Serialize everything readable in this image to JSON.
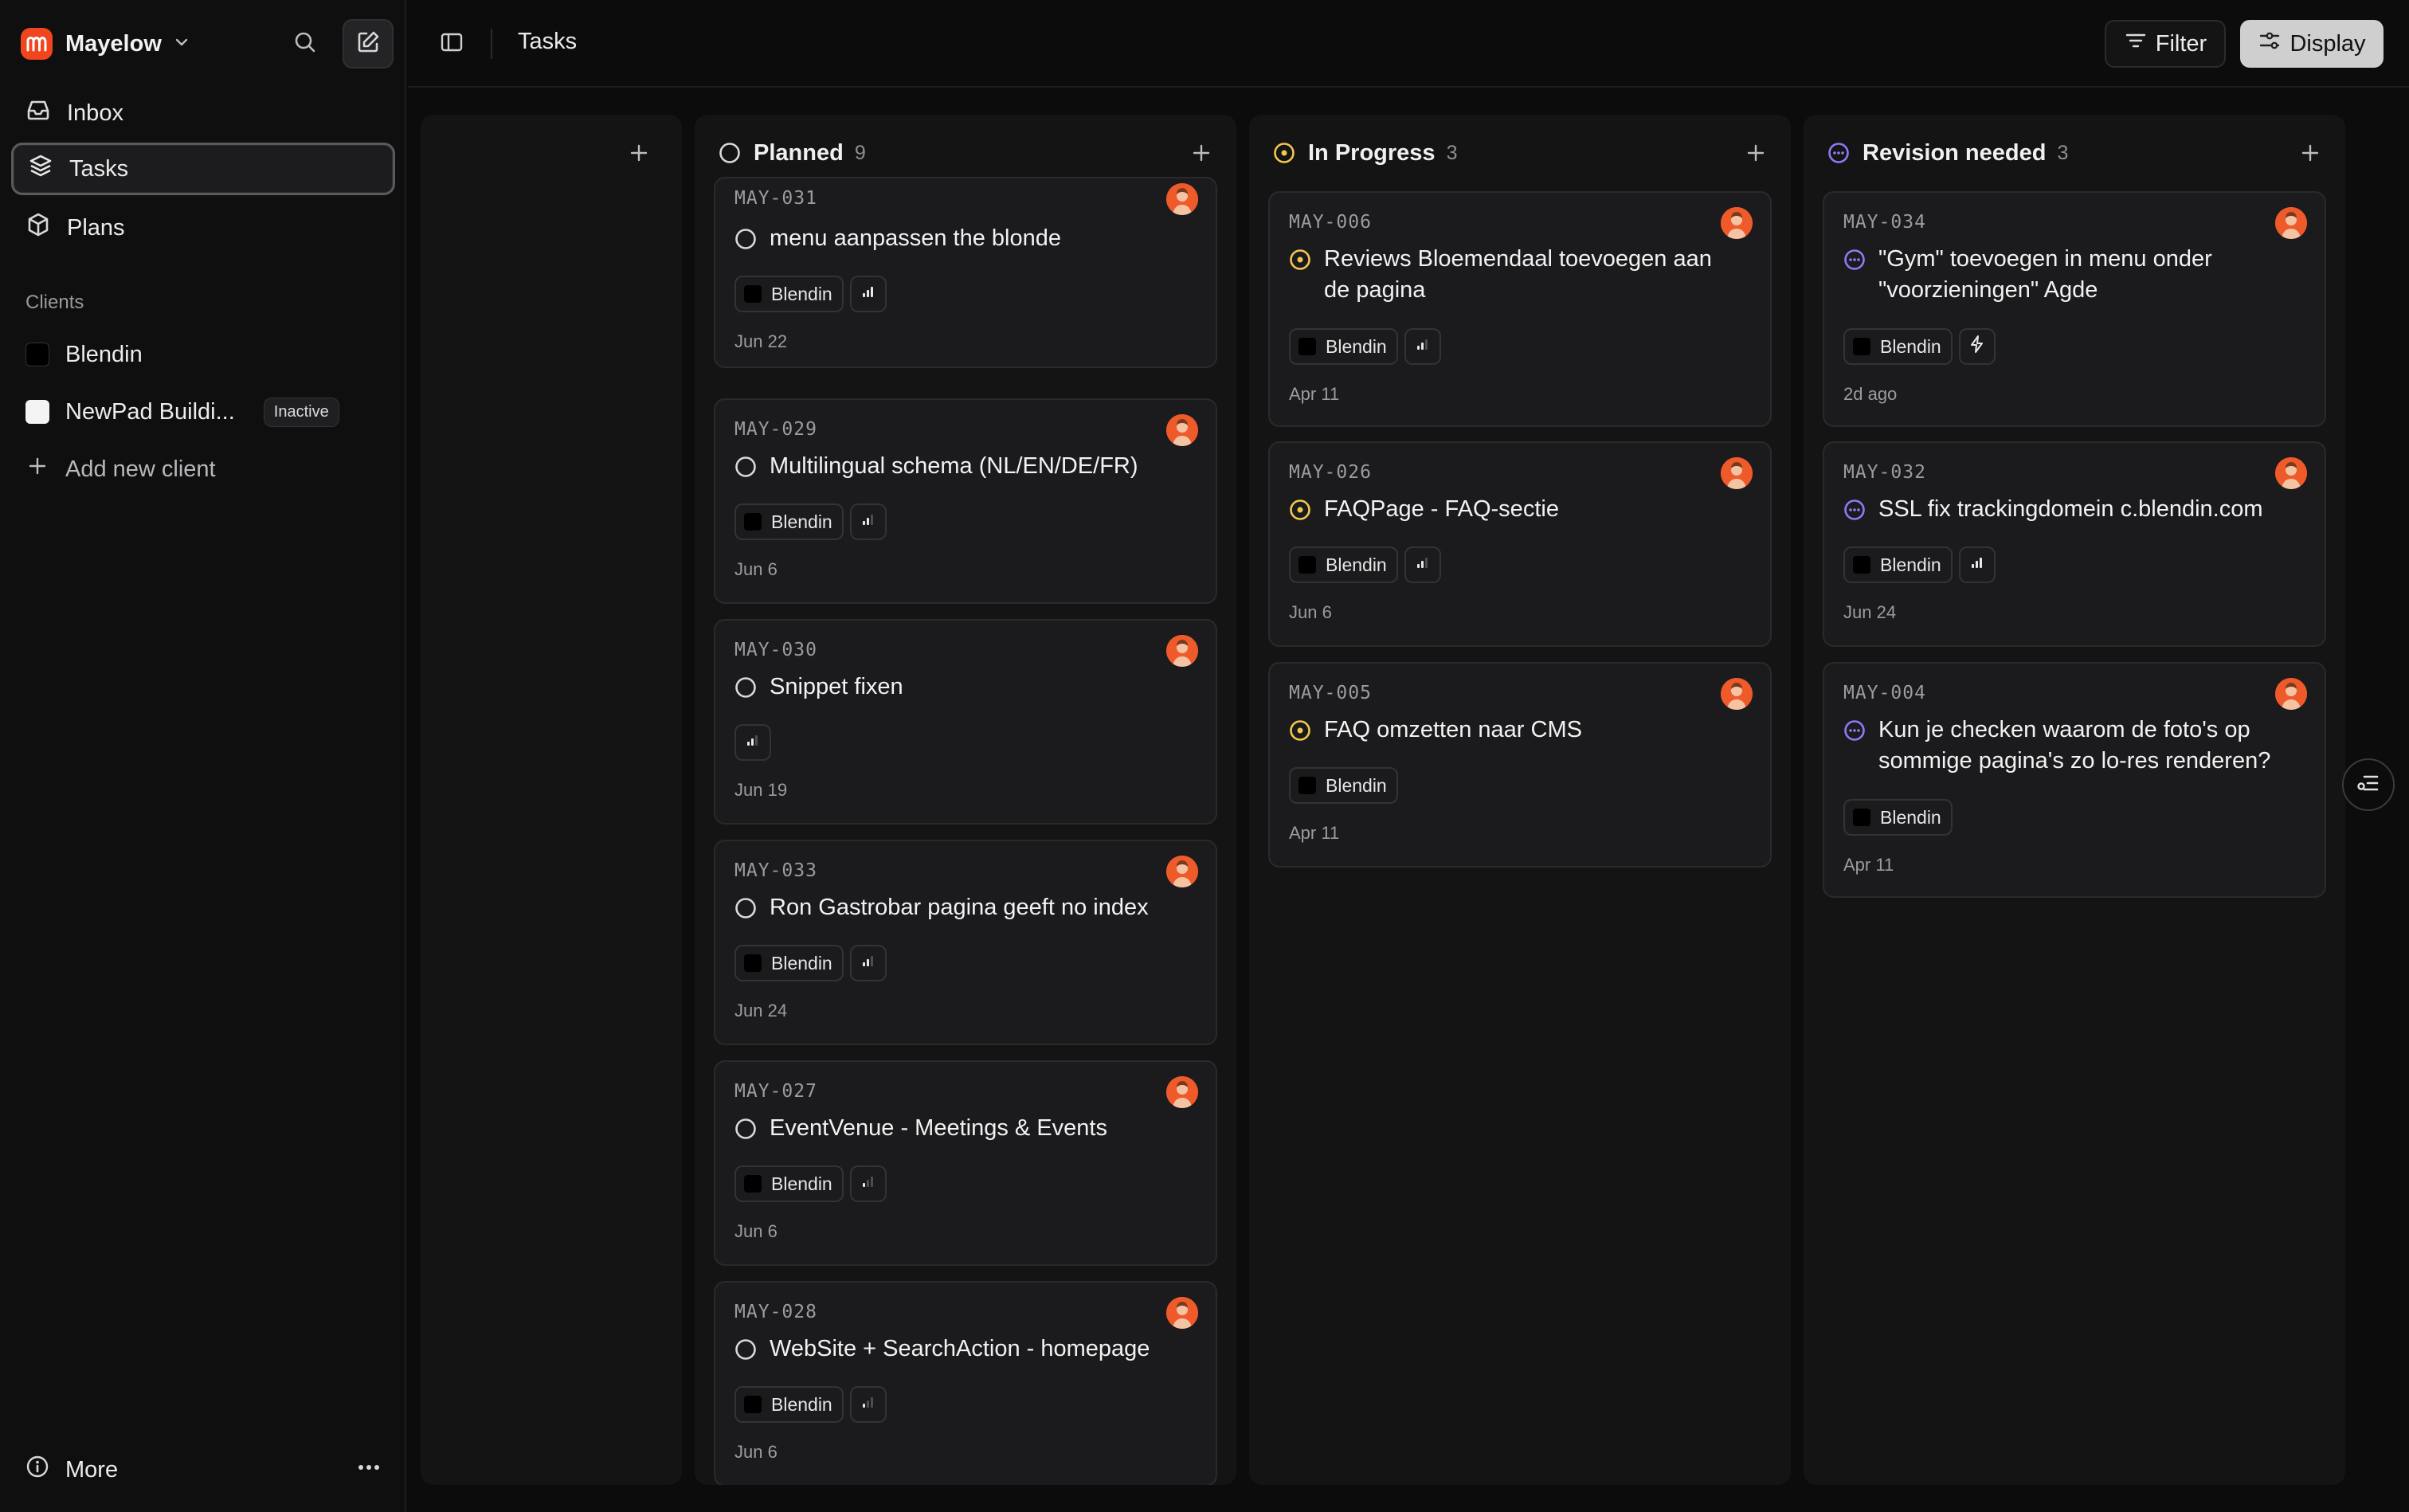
{
  "sidebar": {
    "workspace_name": "Mayelow",
    "nav": [
      {
        "label": "Inbox",
        "icon": "inbox-icon"
      },
      {
        "label": "Tasks",
        "icon": "layers-icon",
        "active": true
      },
      {
        "label": "Plans",
        "icon": "box-icon"
      }
    ],
    "clients_label": "Clients",
    "clients": [
      {
        "label": "Blendin"
      },
      {
        "label": "NewPad Buildi...",
        "badge": "Inactive"
      }
    ],
    "add_client_label": "Add new client",
    "more_label": "More"
  },
  "topbar": {
    "title": "Tasks",
    "filter_label": "Filter",
    "display_label": "Display"
  },
  "colors": {
    "accent": "#f0451f",
    "planned": "#d9d9d9",
    "in_progress": "#f2c94c",
    "revision": "#8b7cf6"
  },
  "columns": [
    {
      "title": "Planned",
      "count": "9",
      "status": "planned",
      "cards": [
        {
          "id": "MAY-031",
          "title": "menu aanpassen the blonde",
          "client": "Blendin",
          "priority": "high",
          "date": "Jun 22"
        },
        {
          "id": "MAY-029",
          "title": "Multilingual schema (NL/EN/DE/FR)",
          "client": "Blendin",
          "priority": "medium",
          "date": "Jun 6"
        },
        {
          "id": "MAY-030",
          "title": "Snippet fixen",
          "client": "",
          "priority": "medium",
          "date": "Jun 19"
        },
        {
          "id": "MAY-033",
          "title": "Ron Gastrobar pagina geeft no index",
          "client": "Blendin",
          "priority": "medium",
          "date": "Jun 24"
        },
        {
          "id": "MAY-027",
          "title": "EventVenue - Meetings & Events",
          "client": "Blendin",
          "priority": "low",
          "date": "Jun 6"
        },
        {
          "id": "MAY-028",
          "title": "WebSite + SearchAction - homepage",
          "client": "Blendin",
          "priority": "low",
          "date": "Jun 6"
        }
      ]
    },
    {
      "title": "In Progress",
      "count": "3",
      "status": "in_progress",
      "cards": [
        {
          "id": "MAY-006",
          "title": "Reviews Bloemendaal toevoegen aan de pagina",
          "client": "Blendin",
          "priority": "medium",
          "date": "Apr 11"
        },
        {
          "id": "MAY-026",
          "title": "FAQPage - FAQ-sectie",
          "client": "Blendin",
          "priority": "medium",
          "date": "Jun 6"
        },
        {
          "id": "MAY-005",
          "title": "FAQ omzetten naar CMS",
          "client": "Blendin",
          "priority": "none",
          "date": "Apr 11"
        }
      ]
    },
    {
      "title": "Revision needed",
      "count": "3",
      "status": "revision",
      "cards": [
        {
          "id": "MAY-034",
          "title": "\"Gym\" toevoegen in menu onder \"voorzieningen\" Agde",
          "client": "Blendin",
          "priority": "urgent",
          "date": "2d ago"
        },
        {
          "id": "MAY-032",
          "title": "SSL fix trackingdomein c.blendin.com",
          "client": "Blendin",
          "priority": "high",
          "date": "Jun 24"
        },
        {
          "id": "MAY-004",
          "title": "Kun je checken waarom de foto's op sommige pagina's zo lo-res renderen?",
          "client": "Blendin",
          "priority": "none",
          "date": "Apr 11"
        }
      ]
    }
  ]
}
